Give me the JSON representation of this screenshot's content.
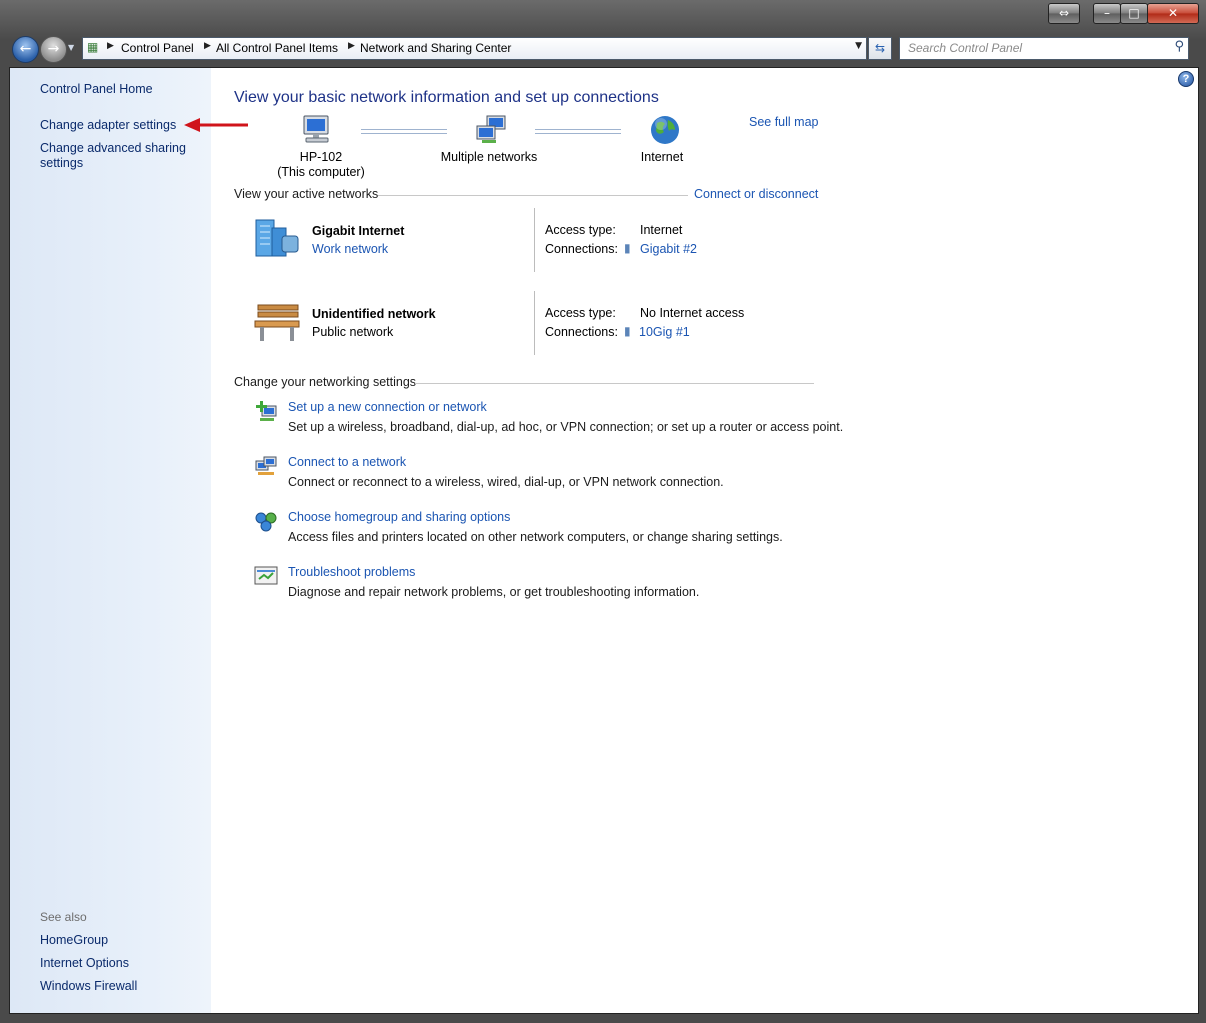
{
  "window": {
    "caption_buttons": {
      "snap": "⇔",
      "minimize": "–",
      "maximize": "□",
      "close": "✕"
    }
  },
  "nav": {
    "breadcrumbs": [
      "Control Panel",
      "All Control Panel Items",
      "Network and Sharing Center"
    ],
    "search_placeholder": "Search Control Panel"
  },
  "sidebar": {
    "home": "Control Panel Home",
    "change_adapter": "Change adapter settings",
    "change_sharing": "Change advanced sharing settings",
    "see_also_title": "See also",
    "see_also": [
      "HomeGroup",
      "Internet Options",
      "Windows Firewall"
    ]
  },
  "main": {
    "title": "View your basic network information and set up connections",
    "see_full_map": "See full map",
    "map": {
      "computer_name": "HP-102",
      "computer_note": "(This computer)",
      "middle": "Multiple networks",
      "internet": "Internet"
    },
    "active_title": "View your active networks",
    "connect_disconnect": "Connect or disconnect",
    "networks": [
      {
        "name": "Gigabit Internet",
        "category": "Work network",
        "category_is_link": true,
        "access_label": "Access type:",
        "access_value": "Internet",
        "connections_label": "Connections:",
        "connection": "Gigabit #2"
      },
      {
        "name": "Unidentified network",
        "category": "Public network",
        "category_is_link": false,
        "access_label": "Access type:",
        "access_value": "No Internet access",
        "connections_label": "Connections:",
        "connection": "10Gig #1"
      }
    ],
    "change_title": "Change your networking settings",
    "tasks": [
      {
        "link": "Set up a new connection or network",
        "desc": "Set up a wireless, broadband, dial-up, ad hoc, or VPN connection; or set up a router or access point."
      },
      {
        "link": "Connect to a network",
        "desc": "Connect or reconnect to a wireless, wired, dial-up, or VPN network connection."
      },
      {
        "link": "Choose homegroup and sharing options",
        "desc": "Access files and printers located on other network computers, or change sharing settings."
      },
      {
        "link": "Troubleshoot problems",
        "desc": "Diagnose and repair network problems, or get troubleshooting information."
      }
    ]
  },
  "colors": {
    "link": "#1b55b2",
    "heading": "#1e3287",
    "sidebar_link": "#0a2a6b",
    "annotation_arrow": "#d0141b"
  }
}
